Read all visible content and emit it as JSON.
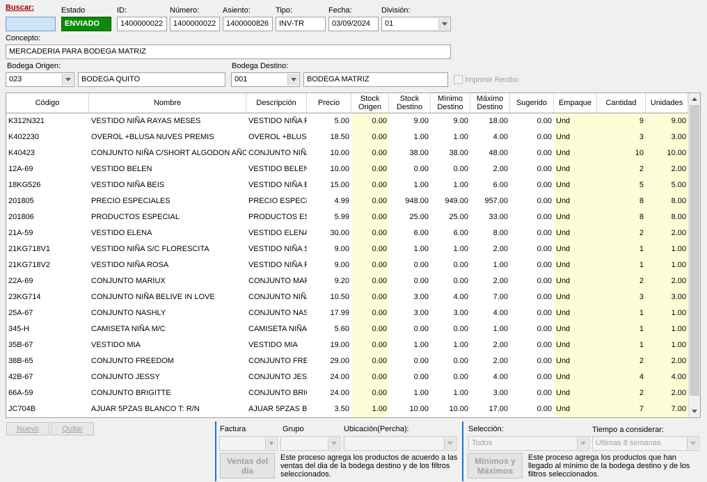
{
  "header": {
    "buscar_label": "Buscar:",
    "buscar_value": "",
    "estado_label": "Estado",
    "estado_value": "ENVIADO",
    "id_label": "ID:",
    "id_value": "1400000022",
    "numero_label": "Número:",
    "numero_value": "1400000022",
    "asiento_label": "Asiento:",
    "asiento_value": "1400000826",
    "tipo_label": "Tipo:",
    "tipo_value": "INV-TR",
    "fecha_label": "Fecha:",
    "fecha_value": "03/09/2024",
    "division_label": "División:",
    "division_value": "01",
    "concepto_label": "Concepto:",
    "concepto_value": "MERCADERIA PARA BODEGA MATRIZ",
    "bodega_origen_label": "Bodega Origen:",
    "bodega_origen_code": "023",
    "bodega_origen_name": "BODEGA QUITO",
    "bodega_destino_label": "Bodega Destino:",
    "bodega_destino_code": "001",
    "bodega_destino_name": "BODEGA MATRIZ",
    "imprimir_label": "Imprimir Recibo"
  },
  "grid": {
    "columns": [
      {
        "label": "Código"
      },
      {
        "label": "Nombre"
      },
      {
        "label": "Descripción"
      },
      {
        "label": "Precio"
      },
      {
        "label": "Stock Origen"
      },
      {
        "label": "Stock Destino"
      },
      {
        "label": "Mínimo Destino"
      },
      {
        "label": "Máximo Destino"
      },
      {
        "label": "Sugerido"
      },
      {
        "label": "Empaque"
      },
      {
        "label": "Cantidad"
      },
      {
        "label": "Unidades"
      }
    ],
    "rows": [
      [
        "K312N321",
        "VESTIDO NIÑA RAYAS MESES",
        "VESTIDO NIÑA RA",
        "5.00",
        "0.00",
        "9.00",
        "9.00",
        "18.00",
        "0.00",
        "Und",
        "9",
        "9.00"
      ],
      [
        "K402230",
        "OVEROL +BLUSA NUVES PREMIS",
        "OVEROL +BLUSA N",
        "18.50",
        "0.00",
        "1.00",
        "1.00",
        "4.00",
        "0.00",
        "Und",
        "3",
        "3.00"
      ],
      [
        "K40423",
        "CONJUNTO NIÑA C/SHORT ALGODON AÑOS",
        "CONJUNTO NIÑA",
        "10.00",
        "0.00",
        "38.00",
        "38.00",
        "48.00",
        "0.00",
        "Und",
        "10",
        "10.00"
      ],
      [
        "12A-69",
        "VESTIDO BELEN",
        "VESTIDO BELEN",
        "10.00",
        "0.00",
        "0.00",
        "0.00",
        "2.00",
        "0.00",
        "Und",
        "2",
        "2.00"
      ],
      [
        "18KG526",
        "VESTIDO NIÑA BEIS",
        "VESTIDO NIÑA BE",
        "15.00",
        "0.00",
        "1.00",
        "1.00",
        "6.00",
        "0.00",
        "Und",
        "5",
        "5.00"
      ],
      [
        "201805",
        "PRECIO ESPECIALES",
        "PRECIO ESPECIAL",
        "4.99",
        "0.00",
        "948.00",
        "949.00",
        "957.00",
        "0.00",
        "Und",
        "8",
        "8.00"
      ],
      [
        "201806",
        "PRODUCTOS ESPECIAL",
        "PRODUCTOS ESPI",
        "5.99",
        "0.00",
        "25.00",
        "25.00",
        "33.00",
        "0.00",
        "Und",
        "8",
        "8.00"
      ],
      [
        "21A-59",
        "VESTIDO ELENA",
        "VESTIDO ELENA",
        "30.00",
        "0.00",
        "6.00",
        "6.00",
        "8.00",
        "0.00",
        "Und",
        "2",
        "2.00"
      ],
      [
        "21KG718V1",
        "VESTIDO NIÑA S/C FLORESCITA",
        "VESTIDO NIÑA S/",
        "9.00",
        "0.00",
        "1.00",
        "1.00",
        "2.00",
        "0.00",
        "Und",
        "1",
        "1.00"
      ],
      [
        "21KG718V2",
        "VESTIDO NIÑA ROSA",
        "VESTIDO NIÑA RC",
        "9.00",
        "0.00",
        "0.00",
        "0.00",
        "1.00",
        "0.00",
        "Und",
        "1",
        "1.00"
      ],
      [
        "22A-69",
        "CONJUNTO MARIUX",
        "CONJUNTO MARI",
        "9.20",
        "0.00",
        "0.00",
        "0.00",
        "2.00",
        "0.00",
        "Und",
        "2",
        "2.00"
      ],
      [
        "23KG714",
        "CONJUNTO NIÑA BELIVE IN LOVE",
        "CONJUNTO NIÑA",
        "10.50",
        "0.00",
        "3.00",
        "4.00",
        "7.00",
        "0.00",
        "Und",
        "3",
        "3.00"
      ],
      [
        "25A-67",
        "CONJUNTO  NASHLY",
        "CONJUNTO  NASH",
        "17.99",
        "0.00",
        "3.00",
        "3.00",
        "4.00",
        "0.00",
        "Und",
        "1",
        "1.00"
      ],
      [
        "345-H",
        "CAMISETA NIÑA M/C",
        "CAMISETA NIÑA I",
        "5.60",
        "0.00",
        "0.00",
        "0.00",
        "1.00",
        "0.00",
        "Und",
        "1",
        "1.00"
      ],
      [
        "35B-67",
        "VESTIDO MIA",
        "VESTIDO MIA",
        "19.00",
        "0.00",
        "1.00",
        "1.00",
        "2.00",
        "0.00",
        "Und",
        "1",
        "1.00"
      ],
      [
        "38B-65",
        "CONJUNTO FREEDOM",
        "CONJUNTO FREEI",
        "29.00",
        "0.00",
        "0.00",
        "0.00",
        "2.00",
        "0.00",
        "Und",
        "2",
        "2.00"
      ],
      [
        "42B-67",
        "CONJUNTO JESSY",
        "CONJUNTO JESSY",
        "24.00",
        "0.00",
        "0.00",
        "0.00",
        "4.00",
        "0.00",
        "Und",
        "4",
        "4.00"
      ],
      [
        "66A-59",
        "CONJUNTO BRIGITTE",
        "CONJUNTO BRIGI",
        "24.00",
        "0.00",
        "1.00",
        "1.00",
        "3.00",
        "0.00",
        "Und",
        "2",
        "2.00"
      ],
      [
        "JC704B",
        "AJUAR 5PZAS BLANCO T: R/N",
        "AJUAR 5PZAS BLA",
        "3.50",
        "1.00",
        "10.00",
        "10.00",
        "17.00",
        "0.00",
        "Und",
        "7",
        "7.00"
      ]
    ]
  },
  "footer": {
    "nuevo_label": "Nuevo",
    "quitar_label": "Quitar",
    "factura_label": "Factura",
    "grupo_label": "Grupo",
    "ubicacion_label": "Ubicación(Percha):",
    "ventas_button_label": "Ventas del día",
    "ventas_desc": "Este proceso agrega los productos de acuerdo a las ventas del dia de la bodega destino y de los filtros seleccionados.",
    "seleccion_label": "Selección:",
    "seleccion_value": "Todos",
    "tiempo_label": "Tiempo a considerar:",
    "tiempo_value": "Ultimas 8 semanas",
    "minmax_button_label": "Mínimos y Máximos",
    "minmax_desc": "Este proceso agrega los productos que han llegado al mínimo de la bodega destino y de los filtros seleccionados."
  }
}
